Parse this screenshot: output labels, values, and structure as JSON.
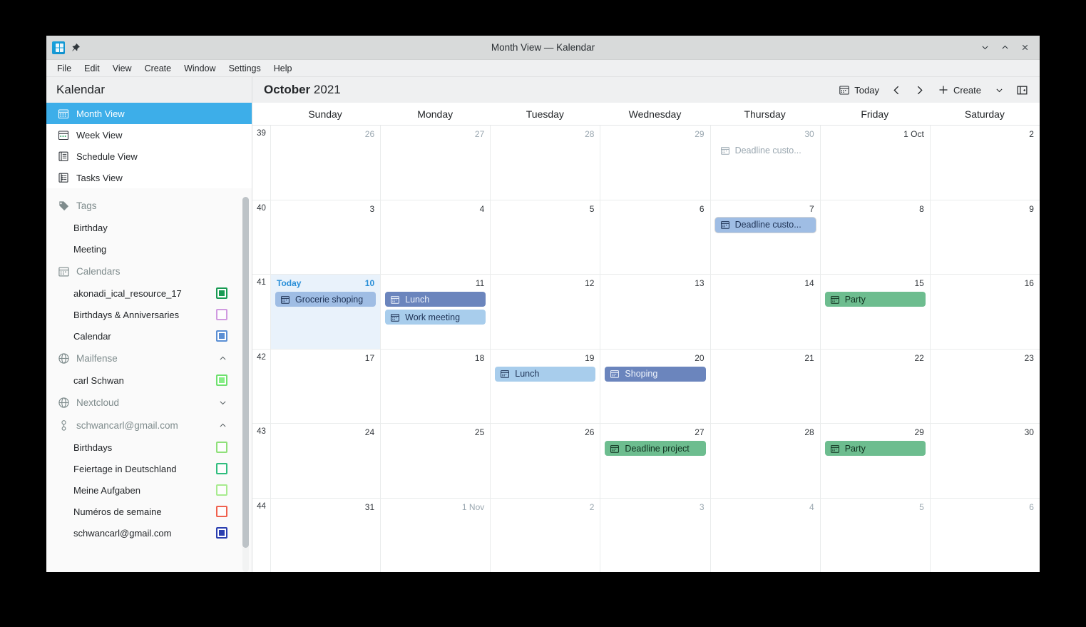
{
  "window": {
    "title": "Month View — Kalendar",
    "app_icon": "kalendar-app-icon",
    "pin_icon": "pin-icon",
    "controls": [
      {
        "name": "minimize-button",
        "icon": "chevron-down-icon"
      },
      {
        "name": "maximize-button",
        "icon": "chevron-up-icon"
      },
      {
        "name": "close-button",
        "icon": "close-icon"
      }
    ]
  },
  "menubar": {
    "items": [
      {
        "label": "File"
      },
      {
        "label": "Edit"
      },
      {
        "label": "View"
      },
      {
        "label": "Create"
      },
      {
        "label": "Window"
      },
      {
        "label": "Settings"
      },
      {
        "label": "Help"
      }
    ]
  },
  "sidebar": {
    "header": "Kalendar",
    "views": [
      {
        "label": "Month View",
        "icon": "calendar-month-icon",
        "active": true
      },
      {
        "label": "Week View",
        "icon": "calendar-week-icon",
        "active": false
      },
      {
        "label": "Schedule View",
        "icon": "schedule-list-icon",
        "active": false
      },
      {
        "label": "Tasks View",
        "icon": "tasks-list-icon",
        "active": false
      }
    ],
    "tags_section": {
      "label": "Tags",
      "icon": "tag-icon"
    },
    "tags": [
      {
        "label": "Birthday"
      },
      {
        "label": "Meeting"
      }
    ],
    "calendars_section": {
      "label": "Calendars",
      "icon": "calendar-icon"
    },
    "calendars": [
      {
        "label": "akonadi_ical_resource_17",
        "color": "#1a9b54",
        "filled": true
      },
      {
        "label": "Birthdays & Anniversaries",
        "color": "#d09ae0",
        "filled": false
      },
      {
        "label": "Calendar",
        "color": "#5b8fd4",
        "filled": true
      }
    ],
    "accounts": [
      {
        "label": "Mailfense",
        "icon": "globe-icon",
        "chevron": "chevron-up-icon",
        "expanded": true,
        "items": [
          {
            "label": "carl Schwan",
            "color": "#6fe06f",
            "filled": true
          }
        ]
      },
      {
        "label": "Nextcloud",
        "icon": "globe-icon",
        "chevron": "chevron-down-icon",
        "expanded": false,
        "items": []
      },
      {
        "label": "schwancarl@gmail.com",
        "icon": "person-key-icon",
        "chevron": "chevron-up-icon",
        "expanded": true,
        "items": [
          {
            "label": "Birthdays",
            "color": "#8fe07a",
            "filled": false
          },
          {
            "label": "Feiertage in Deutschland",
            "color": "#2fbd7e",
            "filled": false
          },
          {
            "label": "Meine Aufgaben",
            "color": "#a8eb8f",
            "filled": false
          },
          {
            "label": "Numéros de semaine",
            "color": "#f0604d",
            "filled": false
          },
          {
            "label": "schwancarl@gmail.com",
            "color": "#2b3fb0",
            "filled": true
          }
        ]
      }
    ]
  },
  "toolbar": {
    "month": "October",
    "year": "2021",
    "today_label": "Today",
    "today_icon": "calendar-today-icon",
    "prev_icon": "chevron-left-icon",
    "next_icon": "chevron-right-icon",
    "create_label": "Create",
    "create_icon": "plus-icon",
    "create_dropdown_icon": "chevron-down-icon",
    "panel_toggle_icon": "sidebar-panel-icon"
  },
  "calendar": {
    "day_names": [
      "Sunday",
      "Monday",
      "Tuesday",
      "Wednesday",
      "Thursday",
      "Friday",
      "Saturday"
    ],
    "weeks": [
      {
        "week_number": "39",
        "days": [
          {
            "num": "26",
            "other_month": true,
            "today": false,
            "events": []
          },
          {
            "num": "27",
            "other_month": true,
            "today": false,
            "events": []
          },
          {
            "num": "28",
            "other_month": true,
            "today": false,
            "events": []
          },
          {
            "num": "29",
            "other_month": true,
            "today": false,
            "events": []
          },
          {
            "num": "30",
            "other_month": true,
            "today": false,
            "events": [
              {
                "title": "Deadline custo...",
                "style": "ghost",
                "icon": "calendar-event-icon"
              }
            ]
          },
          {
            "num": "1 Oct",
            "other_month": false,
            "today": false,
            "events": []
          },
          {
            "num": "2",
            "other_month": false,
            "today": false,
            "events": []
          }
        ]
      },
      {
        "week_number": "40",
        "days": [
          {
            "num": "3",
            "other_month": false,
            "today": false,
            "events": []
          },
          {
            "num": "4",
            "other_month": false,
            "today": false,
            "events": []
          },
          {
            "num": "5",
            "other_month": false,
            "today": false,
            "events": []
          },
          {
            "num": "6",
            "other_month": false,
            "today": false,
            "events": []
          },
          {
            "num": "7",
            "other_month": false,
            "today": false,
            "events": [
              {
                "title": "Deadline custo...",
                "style": "blue-mid",
                "icon": "calendar-event-icon",
                "selected": true
              }
            ]
          },
          {
            "num": "8",
            "other_month": false,
            "today": false,
            "events": []
          },
          {
            "num": "9",
            "other_month": false,
            "today": false,
            "events": []
          }
        ]
      },
      {
        "week_number": "41",
        "days": [
          {
            "num": "10",
            "other_month": false,
            "today": true,
            "today_label": "Today",
            "events": [
              {
                "title": "Grocerie shoping",
                "style": "blue-mid",
                "icon": "calendar-event-icon"
              }
            ]
          },
          {
            "num": "11",
            "other_month": false,
            "today": false,
            "events": [
              {
                "title": "Lunch",
                "style": "blue-dark",
                "icon": "calendar-event-icon"
              },
              {
                "title": "Work meeting",
                "style": "blue-light",
                "icon": "calendar-event-icon"
              }
            ]
          },
          {
            "num": "12",
            "other_month": false,
            "today": false,
            "events": []
          },
          {
            "num": "13",
            "other_month": false,
            "today": false,
            "events": []
          },
          {
            "num": "14",
            "other_month": false,
            "today": false,
            "events": []
          },
          {
            "num": "15",
            "other_month": false,
            "today": false,
            "events": [
              {
                "title": "Party",
                "style": "green",
                "icon": "calendar-event-icon"
              }
            ]
          },
          {
            "num": "16",
            "other_month": false,
            "today": false,
            "events": []
          }
        ]
      },
      {
        "week_number": "42",
        "days": [
          {
            "num": "17",
            "other_month": false,
            "today": false,
            "events": []
          },
          {
            "num": "18",
            "other_month": false,
            "today": false,
            "events": []
          },
          {
            "num": "19",
            "other_month": false,
            "today": false,
            "events": [
              {
                "title": "Lunch",
                "style": "blue-light",
                "icon": "calendar-event-icon"
              }
            ]
          },
          {
            "num": "20",
            "other_month": false,
            "today": false,
            "events": [
              {
                "title": "Shoping",
                "style": "blue-dark",
                "icon": "calendar-event-icon"
              }
            ]
          },
          {
            "num": "21",
            "other_month": false,
            "today": false,
            "events": []
          },
          {
            "num": "22",
            "other_month": false,
            "today": false,
            "events": []
          },
          {
            "num": "23",
            "other_month": false,
            "today": false,
            "events": []
          }
        ]
      },
      {
        "week_number": "43",
        "days": [
          {
            "num": "24",
            "other_month": false,
            "today": false,
            "events": []
          },
          {
            "num": "25",
            "other_month": false,
            "today": false,
            "events": []
          },
          {
            "num": "26",
            "other_month": false,
            "today": false,
            "events": []
          },
          {
            "num": "27",
            "other_month": false,
            "today": false,
            "events": [
              {
                "title": "Deadline project",
                "style": "green",
                "icon": "calendar-event-icon"
              }
            ]
          },
          {
            "num": "28",
            "other_month": false,
            "today": false,
            "events": []
          },
          {
            "num": "29",
            "other_month": false,
            "today": false,
            "events": [
              {
                "title": "Party",
                "style": "green",
                "icon": "calendar-event-icon"
              }
            ]
          },
          {
            "num": "30",
            "other_month": false,
            "today": false,
            "events": []
          }
        ]
      },
      {
        "week_number": "44",
        "days": [
          {
            "num": "31",
            "other_month": false,
            "today": false,
            "events": []
          },
          {
            "num": "1 Nov",
            "other_month": true,
            "today": false,
            "events": []
          },
          {
            "num": "2",
            "other_month": true,
            "today": false,
            "events": []
          },
          {
            "num": "3",
            "other_month": true,
            "today": false,
            "events": []
          },
          {
            "num": "4",
            "other_month": true,
            "today": false,
            "events": []
          },
          {
            "num": "5",
            "other_month": true,
            "today": false,
            "events": []
          },
          {
            "num": "6",
            "other_month": true,
            "today": false,
            "events": []
          }
        ]
      }
    ]
  },
  "colors": {
    "accent": "#3daee9",
    "today_bg": "#e9f2fb",
    "event_blue_dark": "#6b85bd",
    "event_blue_mid": "#9fbde4",
    "event_blue_light": "#a8cdec",
    "event_green": "#6dbd8f",
    "titlebar_bg": "#d8dada",
    "menubar_bg": "#eff0f1"
  }
}
